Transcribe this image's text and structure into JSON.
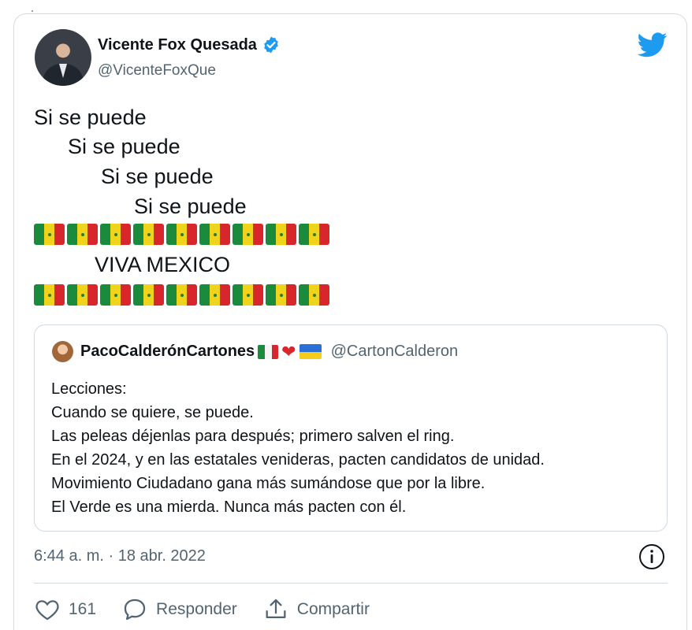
{
  "tweet": {
    "author_name": "Vicente Fox Quesada",
    "author_handle": "@VicenteFoxQue",
    "lines": [
      "Si se puede",
      "Si se puede",
      "Si se puede",
      "Si se puede"
    ],
    "flag_row_count": 9,
    "shout": "VIVA MEXICO",
    "timestamp": "6:44 a. m. · 18 abr. 2022"
  },
  "quoted_tweet": {
    "author_name": "PacoCalderónCartones",
    "author_handle": "@CartonCalderon",
    "lines": [
      "Lecciones:",
      "Cuando se quiere, se puede.",
      "Las peleas déjenlas para después; primero salven el ring.",
      "En el 2024, y en las estatales venideras, pacten candidatos de unidad.",
      "Movimiento Ciudadano gana más sumándose que por la libre.",
      "El Verde es una mierda. Nunca más pacten con él."
    ]
  },
  "actions": {
    "likes_count": "161",
    "reply_label": "Responder",
    "share_label": "Compartir"
  },
  "icons": {
    "verified": "verified-badge-icon",
    "brand": "twitter-bird-icon",
    "info": "info-icon",
    "like": "heart-icon",
    "reply": "speech-bubble-icon",
    "share": "share-upload-icon"
  },
  "colors": {
    "brand_blue": "#1d9bf0",
    "text_primary": "#0f1419",
    "text_secondary": "#536471",
    "border": "#cfd9de",
    "flag_green": "#1a8b3c",
    "flag_yellow": "#f0d41c",
    "flag_red": "#d7262c"
  }
}
